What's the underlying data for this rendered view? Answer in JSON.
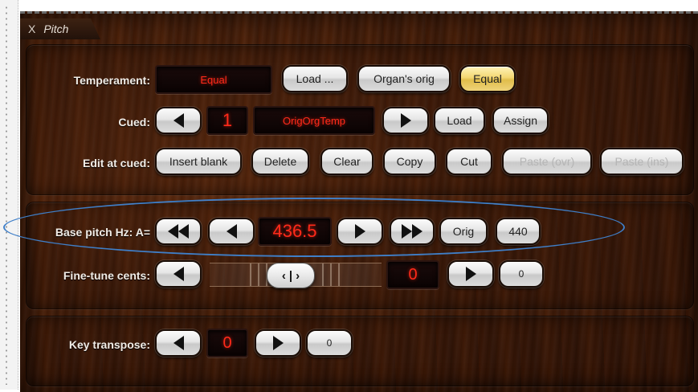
{
  "panel": {
    "close_glyph": "X",
    "title": "Pitch"
  },
  "temperament": {
    "label": "Temperament:",
    "value": "Equal",
    "buttons": {
      "load": "Load ...",
      "organs_orig": "Organ's orig",
      "equal": "Equal"
    }
  },
  "cued": {
    "label": "Cued:",
    "index": "1",
    "name": "OrigOrgTemp",
    "buttons": {
      "load": "Load",
      "assign": "Assign"
    }
  },
  "edit": {
    "label": "Edit at cued:",
    "buttons": {
      "insert_blank": "Insert blank",
      "delete": "Delete",
      "clear": "Clear",
      "copy": "Copy",
      "cut": "Cut",
      "paste_ovr": "Paste (ovr)",
      "paste_ins": "Paste (ins)"
    }
  },
  "base_pitch": {
    "label": "Base pitch Hz: A=",
    "value": "436.5",
    "buttons": {
      "orig": "Orig",
      "preset_440": "440"
    }
  },
  "fine_tune": {
    "label": "Fine-tune cents:",
    "value": "0",
    "reset": "0",
    "slider_position_fraction": 0.5
  },
  "key_transpose": {
    "label": "Key transpose:",
    "value": "0",
    "reset": "0"
  },
  "colors": {
    "display_text": "#ff2a1a",
    "highlight_button": "#f3d773",
    "annotation_oval": "#3f7fc8"
  }
}
